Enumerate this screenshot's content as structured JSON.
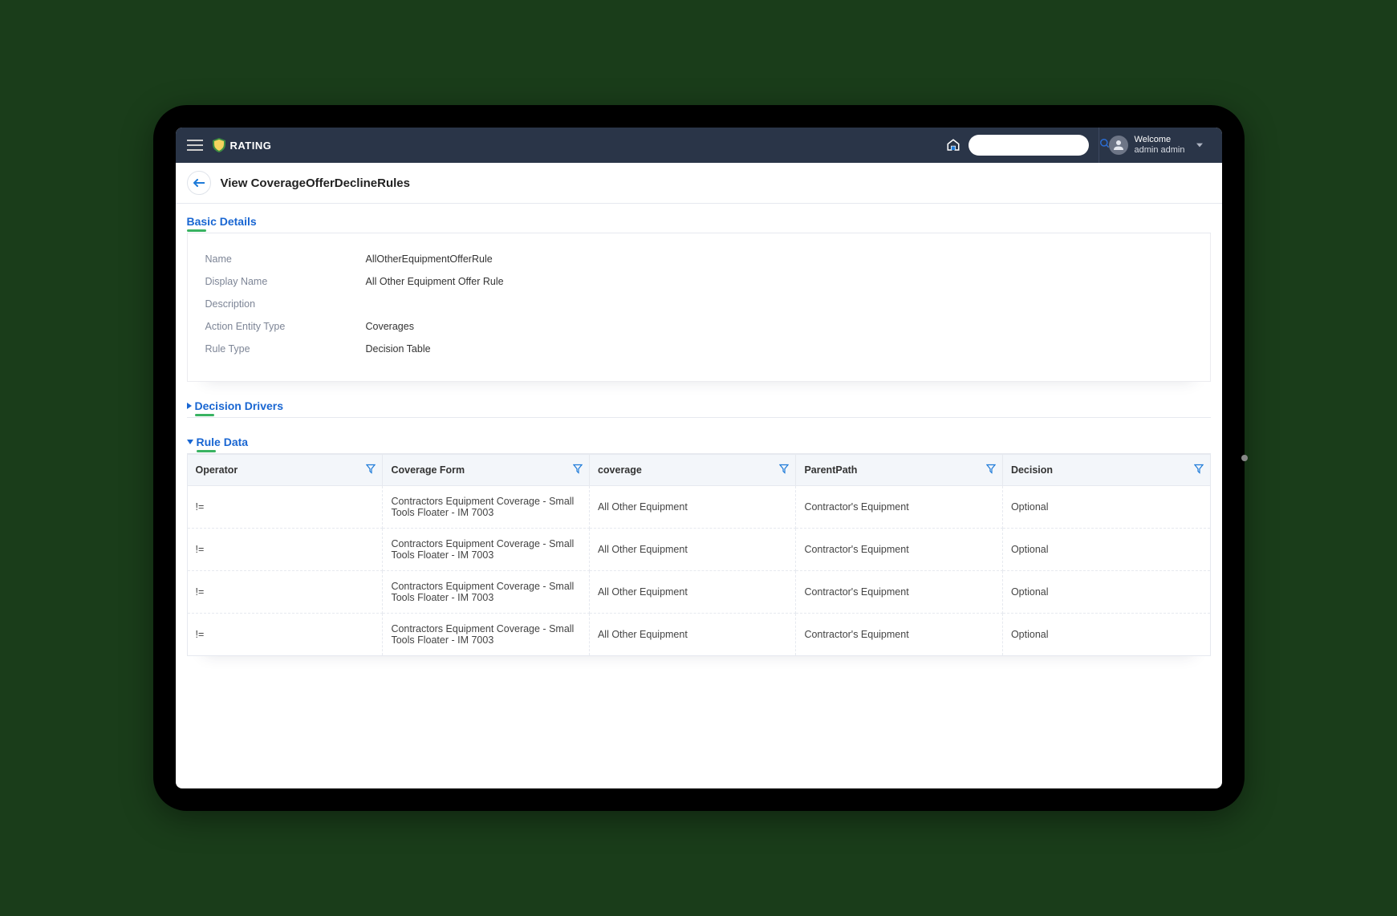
{
  "header": {
    "app_title": "RATING",
    "search_placeholder": "",
    "welcome_label": "Welcome",
    "user_name": "admin admin"
  },
  "page": {
    "title": "View CoverageOfferDeclineRules"
  },
  "sections": {
    "basic": {
      "title": "Basic Details",
      "rows": [
        {
          "label": "Name",
          "value": "AllOtherEquipmentOfferRule"
        },
        {
          "label": "Display Name",
          "value": "All Other Equipment Offer Rule"
        },
        {
          "label": "Description",
          "value": ""
        },
        {
          "label": "Action Entity Type",
          "value": "Coverages"
        },
        {
          "label": "Rule Type",
          "value": "Decision Table"
        }
      ]
    },
    "drivers": {
      "title": "Decision Drivers"
    },
    "ruledata": {
      "title": "Rule Data",
      "columns": [
        "Operator",
        "Coverage Form",
        "coverage",
        "ParentPath",
        "Decision"
      ],
      "rows": [
        {
          "operator": "!=",
          "coverage_form": "Contractors Equipment Coverage - Small Tools Floater - IM 7003",
          "coverage": "All Other Equipment",
          "parent_path": "Contractor's Equipment",
          "decision": "Optional"
        },
        {
          "operator": "!=",
          "coverage_form": "Contractors Equipment Coverage - Small Tools Floater - IM 7003",
          "coverage": "All Other Equipment",
          "parent_path": "Contractor's Equipment",
          "decision": "Optional"
        },
        {
          "operator": "!=",
          "coverage_form": "Contractors Equipment Coverage - Small Tools Floater - IM 7003",
          "coverage": "All Other Equipment",
          "parent_path": "Contractor's Equipment",
          "decision": "Optional"
        },
        {
          "operator": "!=",
          "coverage_form": "Contractors Equipment Coverage - Small Tools Floater - IM 7003",
          "coverage": "All Other Equipment",
          "parent_path": "Contractor's Equipment",
          "decision": "Optional"
        }
      ]
    }
  }
}
